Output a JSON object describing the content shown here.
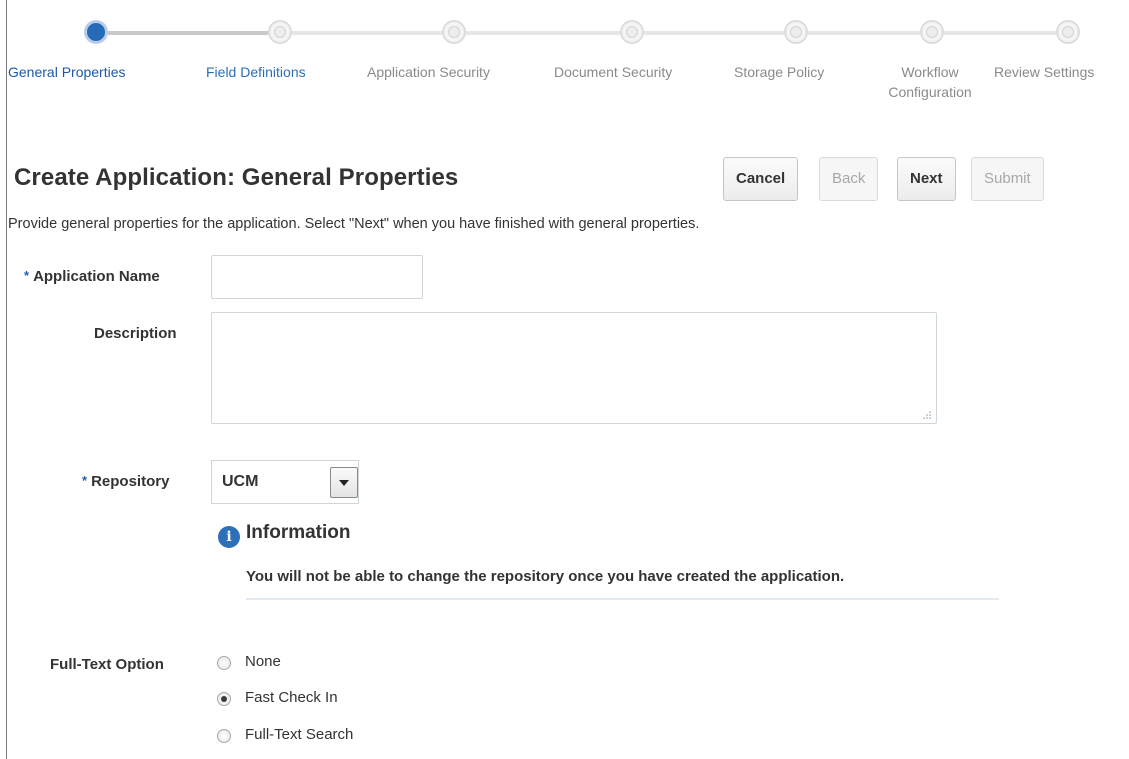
{
  "wizard": {
    "steps": [
      {
        "label": "General Properties",
        "state": "current"
      },
      {
        "label": "Field Definitions",
        "state": "visited"
      },
      {
        "label": "Application Security",
        "state": "disabled"
      },
      {
        "label": "Document Security",
        "state": "disabled"
      },
      {
        "label": "Storage Policy",
        "state": "disabled"
      },
      {
        "label_line1": "Workflow",
        "label_line2": "Configuration",
        "state": "disabled"
      },
      {
        "label": "Review Settings",
        "state": "disabled"
      }
    ]
  },
  "header": {
    "title": "Create Application: General Properties",
    "buttons": {
      "cancel": "Cancel",
      "back": "Back",
      "next": "Next",
      "submit": "Submit"
    }
  },
  "intro_text": "Provide general properties for the application. Select \"Next\" when you have finished with general properties.",
  "form": {
    "required_marker": "*",
    "application_name": {
      "label": "Application Name",
      "value": ""
    },
    "description": {
      "label": "Description",
      "value": ""
    },
    "repository": {
      "label": "Repository",
      "value": "UCM"
    },
    "info": {
      "icon": "info-icon",
      "title": "Information",
      "text": "You will not be able to change the repository once you have created the application."
    },
    "full_text": {
      "label": "Full-Text Option",
      "options": [
        {
          "label": "None",
          "checked": false
        },
        {
          "label": "Fast Check In",
          "checked": true
        },
        {
          "label": "Full-Text Search",
          "checked": false
        }
      ]
    }
  },
  "colors": {
    "active_step": "#2569b7",
    "link_blue": "#1c59a8",
    "required_marker": "#2a5fa3",
    "info_icon": "#2d6fb8"
  }
}
